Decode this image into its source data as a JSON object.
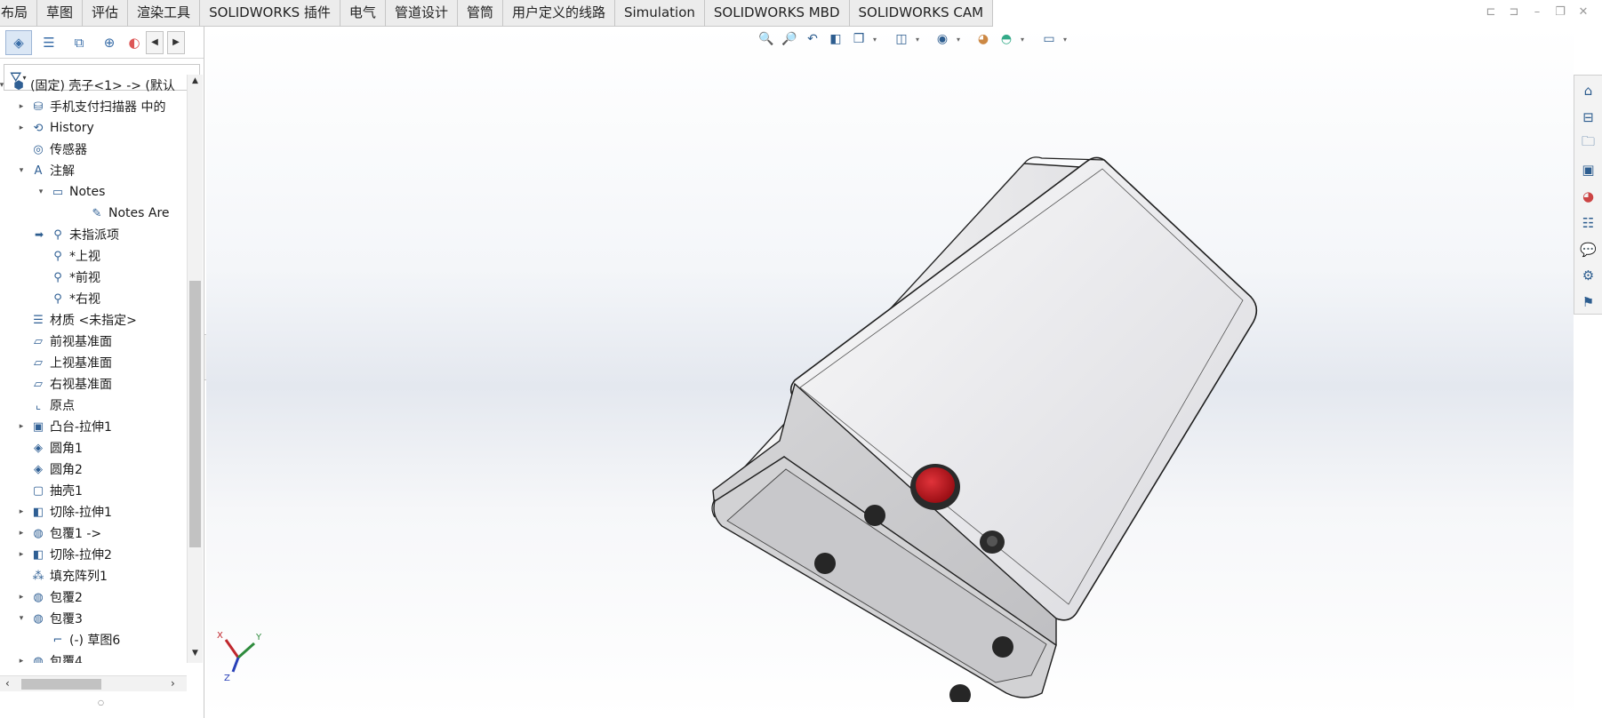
{
  "command_tabs": [
    "布局",
    "草图",
    "评估",
    "渲染工具",
    "SOLIDWORKS 插件",
    "电气",
    "管道设计",
    "管筒",
    "用户定义的线路",
    "Simulation",
    "SOLIDWORKS MBD",
    "SOLIDWORKS CAM"
  ],
  "panel": {
    "tab_icons": [
      "feature-manager-icon",
      "property-manager-icon",
      "configuration-manager-icon",
      "dimxpert-icon",
      "display-manager-icon"
    ],
    "filter_icon": "filter-icon"
  },
  "tree": [
    {
      "label": "(固定) 壳子<1> -> (默认",
      "level": 0,
      "expand": "open",
      "icon": "part-icon"
    },
    {
      "label": "手机支付扫描器 中的",
      "level": 1,
      "expand": "closed",
      "icon": "folder-icon"
    },
    {
      "label": "History",
      "level": 1,
      "expand": "closed",
      "icon": "history-icon"
    },
    {
      "label": "传感器",
      "level": 1,
      "expand": "none",
      "icon": "sensor-icon"
    },
    {
      "label": "注解",
      "level": 1,
      "expand": "open",
      "icon": "annotation-icon"
    },
    {
      "label": "Notes",
      "level": 2,
      "expand": "open",
      "icon": "notes-folder-icon"
    },
    {
      "label": "Notes Are",
      "level": 4,
      "expand": "none",
      "icon": "notes-area-icon"
    },
    {
      "label": "未指派项",
      "level": 2,
      "expand": "arrow",
      "icon": "view-icon"
    },
    {
      "label": "*上视",
      "level": 2,
      "expand": "none",
      "icon": "view-icon"
    },
    {
      "label": "*前视",
      "level": 2,
      "expand": "none",
      "icon": "view-icon"
    },
    {
      "label": "*右视",
      "level": 2,
      "expand": "none",
      "icon": "view-icon"
    },
    {
      "label": "材质 <未指定>",
      "level": 1,
      "expand": "none",
      "icon": "material-icon"
    },
    {
      "label": "前视基准面",
      "level": 1,
      "expand": "none",
      "icon": "plane-icon"
    },
    {
      "label": "上视基准面",
      "level": 1,
      "expand": "none",
      "icon": "plane-icon"
    },
    {
      "label": "右视基准面",
      "level": 1,
      "expand": "none",
      "icon": "plane-icon"
    },
    {
      "label": "原点",
      "level": 1,
      "expand": "none",
      "icon": "origin-icon"
    },
    {
      "label": "凸台-拉伸1",
      "level": 1,
      "expand": "closed",
      "icon": "extrude-icon"
    },
    {
      "label": "圆角1",
      "level": 1,
      "expand": "none",
      "icon": "fillet-icon"
    },
    {
      "label": "圆角2",
      "level": 1,
      "expand": "none",
      "icon": "fillet-icon"
    },
    {
      "label": "抽壳1",
      "level": 1,
      "expand": "none",
      "icon": "shell-icon"
    },
    {
      "label": "切除-拉伸1",
      "level": 1,
      "expand": "closed",
      "icon": "cut-extrude-icon"
    },
    {
      "label": "包覆1 ->",
      "level": 1,
      "expand": "closed",
      "icon": "wrap-icon"
    },
    {
      "label": "切除-拉伸2",
      "level": 1,
      "expand": "closed",
      "icon": "cut-extrude-icon"
    },
    {
      "label": "填充阵列1",
      "level": 1,
      "expand": "none",
      "icon": "fill-pattern-icon"
    },
    {
      "label": "包覆2",
      "level": 1,
      "expand": "closed",
      "icon": "wrap-icon"
    },
    {
      "label": "包覆3",
      "level": 1,
      "expand": "open",
      "icon": "wrap-icon"
    },
    {
      "label": "(-) 草图6",
      "level": 2,
      "expand": "none",
      "icon": "sketch-icon"
    },
    {
      "label": "包覆4",
      "level": 1,
      "expand": "closed",
      "icon": "wrap-icon"
    }
  ],
  "heads_up_toolbar": [
    "zoom-to-fit-icon",
    "zoom-to-area-icon",
    "previous-view-icon",
    "section-view-icon",
    "view-orientation-icon",
    "display-style-icon",
    "hide-show-icon",
    "edit-appearance-icon",
    "apply-scene-icon",
    "view-settings-icon"
  ],
  "task_pane": [
    "home-icon",
    "design-library-icon",
    "file-explorer-icon",
    "view-palette-icon",
    "appearances-icon",
    "custom-properties-icon",
    "forum-icon",
    "toolbox-icon",
    "solidworks-resources-icon"
  ],
  "triad": {
    "x": "X",
    "y": "Y",
    "z": "Z"
  },
  "colors": {
    "button_red": "#c8141c",
    "accent_blue": "#2d5d8f",
    "panel_bg": "#ffffff",
    "tab_bar": "#ececec"
  }
}
